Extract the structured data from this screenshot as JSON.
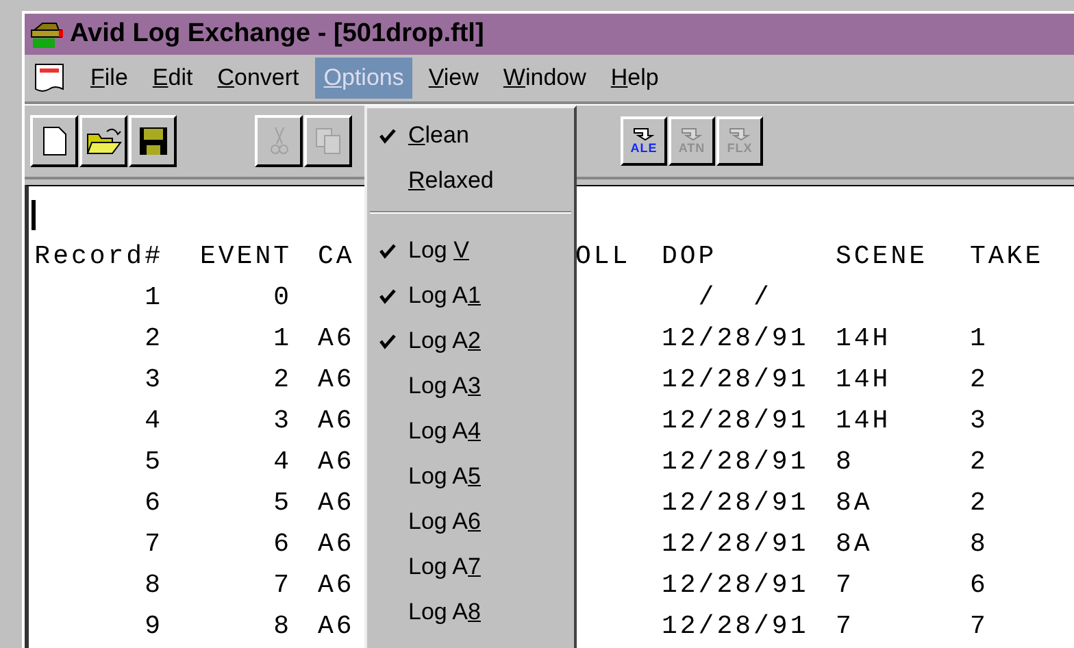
{
  "window": {
    "title": "Avid Log Exchange - [501drop.ftl]"
  },
  "menu_bar": [
    {
      "key": "F",
      "post": "ile",
      "selected": false
    },
    {
      "key": "E",
      "post": "dit",
      "selected": false
    },
    {
      "key": "C",
      "post": "onvert",
      "selected": false
    },
    {
      "key": "O",
      "post": "ptions",
      "selected": true
    },
    {
      "key": "V",
      "post": "iew",
      "selected": false
    },
    {
      "key": "W",
      "post": "indow",
      "selected": false
    },
    {
      "key": "H",
      "post": "elp",
      "selected": false
    }
  ],
  "toolbar": [
    {
      "kind": "new",
      "disabled": false
    },
    {
      "kind": "open",
      "disabled": false
    },
    {
      "kind": "save",
      "disabled": false
    },
    {
      "kind": "sep"
    },
    {
      "kind": "cut",
      "disabled": true
    },
    {
      "kind": "copy",
      "disabled": true
    },
    {
      "kind": "gap"
    },
    {
      "kind": "convert",
      "label": "ALE",
      "disabled": false
    },
    {
      "kind": "convert",
      "label": "ATN",
      "disabled": true
    },
    {
      "kind": "convert",
      "label": "FLX",
      "disabled": true
    }
  ],
  "options_menu": [
    {
      "kind": "item",
      "key": "C",
      "post": "lean",
      "checked": true
    },
    {
      "kind": "item",
      "key": "R",
      "post": "elaxed",
      "checked": false
    },
    {
      "kind": "separator"
    },
    {
      "kind": "item",
      "pre": "Log ",
      "key": "V",
      "checked": true
    },
    {
      "kind": "item",
      "pre": "Log A",
      "key": "1",
      "checked": true
    },
    {
      "kind": "item",
      "pre": "Log A",
      "key": "2",
      "checked": true
    },
    {
      "kind": "item",
      "pre": "Log A",
      "key": "3",
      "checked": false
    },
    {
      "kind": "item",
      "pre": "Log A",
      "key": "4",
      "checked": false
    },
    {
      "kind": "item",
      "pre": "Log A",
      "key": "5",
      "checked": false
    },
    {
      "kind": "item",
      "pre": "Log A",
      "key": "6",
      "checked": false
    },
    {
      "kind": "item",
      "pre": "Log A",
      "key": "7",
      "checked": false
    },
    {
      "kind": "item",
      "pre": "Log A",
      "key": "8",
      "checked": false
    }
  ],
  "log_text": {
    "header": {
      "record": "Record#",
      "event": "EVENT",
      "cam": "CA",
      "roll": "OLL",
      "dop": "DOP",
      "scene": "SCENE",
      "take": "TAKE"
    },
    "rows": [
      {
        "record": "1",
        "event": "0",
        "dop": "  /  /"
      },
      {
        "record": "2",
        "event": "1",
        "cam": "A6",
        "dop": "12/28/91",
        "scene": "14H",
        "take": "1"
      },
      {
        "record": "3",
        "event": "2",
        "cam": "A6",
        "dop": "12/28/91",
        "scene": "14H",
        "take": "2"
      },
      {
        "record": "4",
        "event": "3",
        "cam": "A6",
        "dop": "12/28/91",
        "scene": "14H",
        "take": "3"
      },
      {
        "record": "5",
        "event": "4",
        "cam": "A6",
        "dop": "12/28/91",
        "scene": "8",
        "take": "2"
      },
      {
        "record": "6",
        "event": "5",
        "cam": "A6",
        "dop": "12/28/91",
        "scene": "8A",
        "take": "2"
      },
      {
        "record": "7",
        "event": "6",
        "cam": "A6",
        "dop": "12/28/91",
        "scene": "8A",
        "take": "8"
      },
      {
        "record": "8",
        "event": "7",
        "cam": "A6",
        "dop": "12/28/91",
        "scene": "7",
        "take": "6"
      },
      {
        "record": "9",
        "event": "8",
        "cam": "A6",
        "dop": "12/28/91",
        "scene": "7",
        "take": "7"
      }
    ]
  }
}
